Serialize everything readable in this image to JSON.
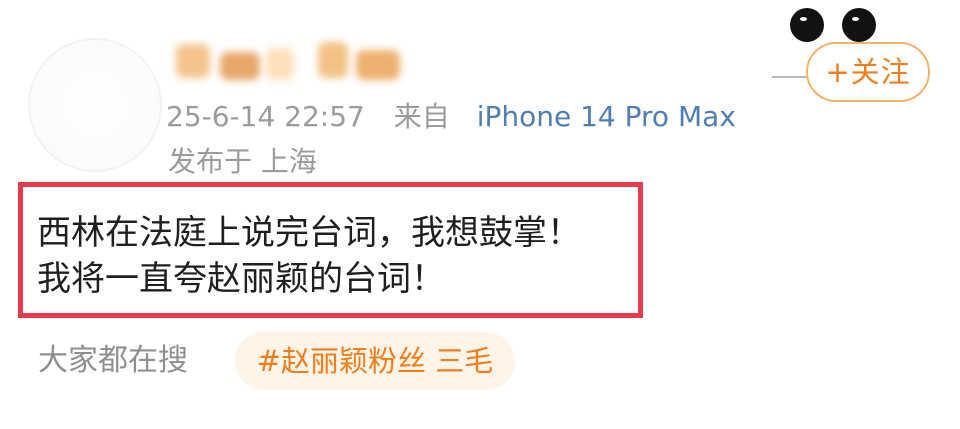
{
  "post": {
    "header": {
      "follow_label": "+关注",
      "meta": {
        "timestamp": "25-6-14 22:57",
        "from_label": "来自",
        "source": "iPhone 14 Pro Max"
      },
      "location": "发布于 上海"
    },
    "content": {
      "line1": "西林在法庭上说完台词，我想鼓掌！",
      "line2": "我将一直夸赵丽颖的台词！"
    },
    "footer": {
      "search_label": "大家都在搜",
      "tag": "#赵丽颖粉丝 三毛"
    },
    "colors": {
      "accent": "#f07e1d",
      "source_blue": "#4f7eb2",
      "meta_gray": "#9b9b9b",
      "highlight_red": "#e63b4f"
    },
    "icons": {
      "avatar": "blank-avatar-circle",
      "badge": "mouse-ears-icon"
    }
  }
}
